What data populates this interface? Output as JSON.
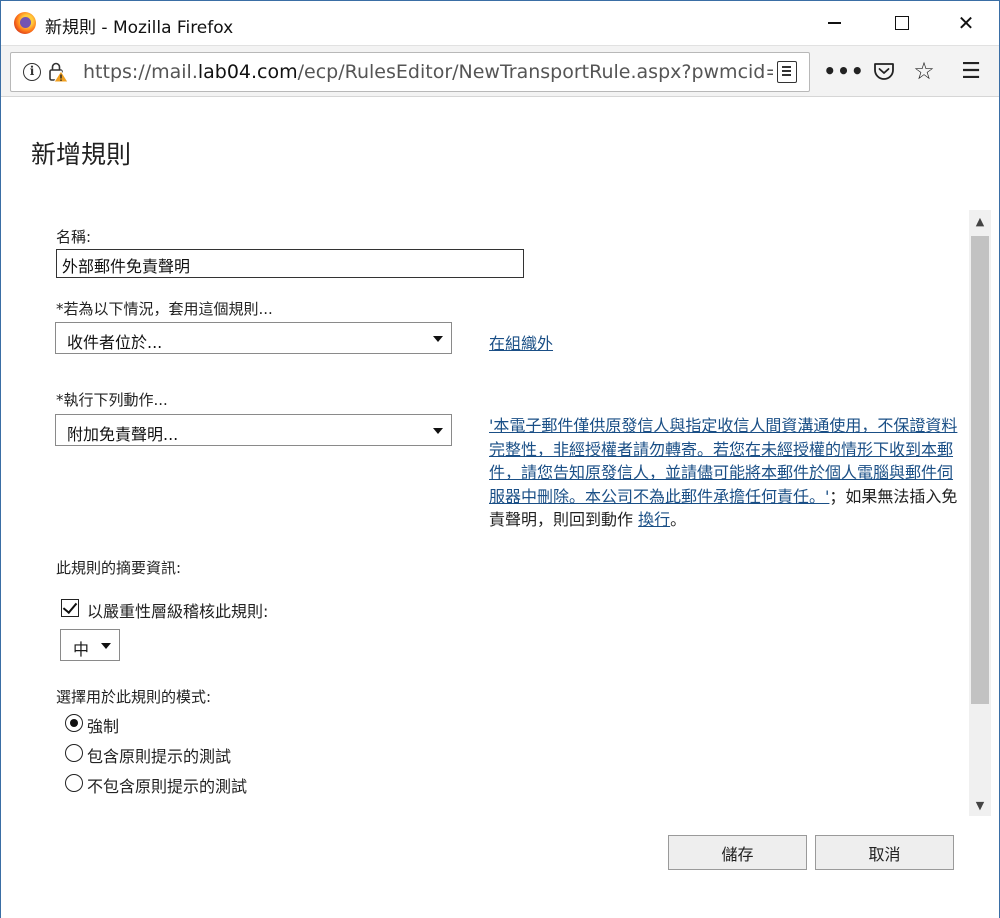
{
  "window": {
    "title": "新規則 - Mozilla Firefox",
    "minimize_glyph": "",
    "close_glyph": "✕"
  },
  "navbar": {
    "url_prefix": "https://mail.",
    "url_domain": "lab04.com",
    "url_rest": "/ecp/RulesEditor/NewTransportRule.aspx?pwmcid=",
    "more_glyph": "•••",
    "star_glyph": "☆",
    "menu_glyph": "☰"
  },
  "page": {
    "title": "新增規則"
  },
  "form": {
    "name_label": "名稱:",
    "name_value": "外部郵件免責聲明",
    "condition_label": "*若為以下情況，套用這個規則...",
    "condition_value": "收件者位於...",
    "condition_link": "在組織外",
    "action_label": "*執行下列動作...",
    "action_value": "附加免責聲明...",
    "disclaimer_link": "'本電子郵件僅供原發信人與指定收信人間資溝通使用，不保證資料完整性，非經授權者請勿轉寄。若您在未經授權的情形下收到本郵件，請您告知原發信人，並請儘可能將本郵件於個人電腦與郵件伺服器中刪除。本公司不為此郵件承擔任何責任。'",
    "disclaimer_suffix": "；如果無法插入免責聲明，則回到動作",
    "fallback_link": "換行",
    "disclaimer_end": "。",
    "summary_label": "此規則的摘要資訊:",
    "audit_label": "以嚴重性層級稽核此規則:",
    "audit_checked": true,
    "severity_value": "中",
    "mode_label": "選擇用於此規則的模式:",
    "modes": [
      {
        "label": "強制",
        "selected": true
      },
      {
        "label": "包含原則提示的測試",
        "selected": false
      },
      {
        "label": "不包含原則提示的測試",
        "selected": false
      }
    ]
  },
  "scrollbar": {
    "up_glyph": "▲",
    "down_glyph": "▼"
  },
  "buttons": {
    "save": "儲存",
    "cancel": "取消"
  }
}
